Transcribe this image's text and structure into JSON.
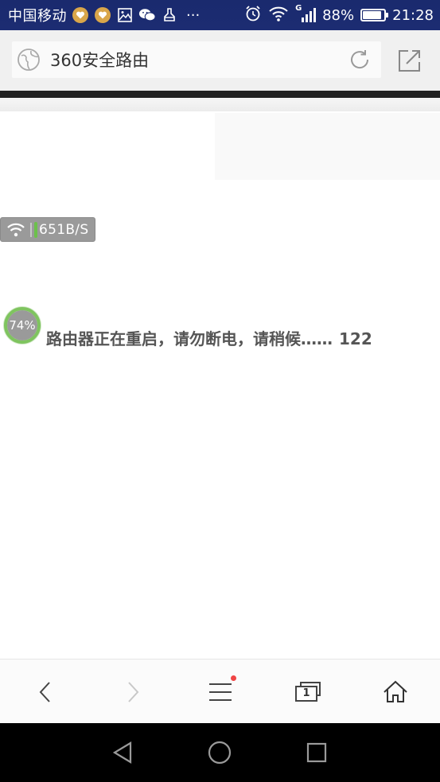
{
  "status_bar": {
    "carrier": "中国移动",
    "notification_icons": [
      "heart-badge-icon",
      "heart-badge-icon",
      "image-icon",
      "wechat-icon",
      "cleaner-icon"
    ],
    "more": "···",
    "battery_percent": "88%",
    "battery_level": 0.88,
    "time": "21:28",
    "network_label": "G"
  },
  "address_bar": {
    "url_text": "360安全路由"
  },
  "speed_badge": {
    "speed": "651B/S"
  },
  "reboot": {
    "progress_label": "74%",
    "progress_value": 0.74,
    "message": "路由器正在重启，请勿断电，请稍候……",
    "count": "122"
  },
  "toolbar": {
    "tab_count": "1",
    "accent_color": "#f04545"
  },
  "colors": {
    "status_bar_bg": "#1c2c72",
    "progress_green": "#6cc14b",
    "progress_gray": "#9a9a9a"
  }
}
